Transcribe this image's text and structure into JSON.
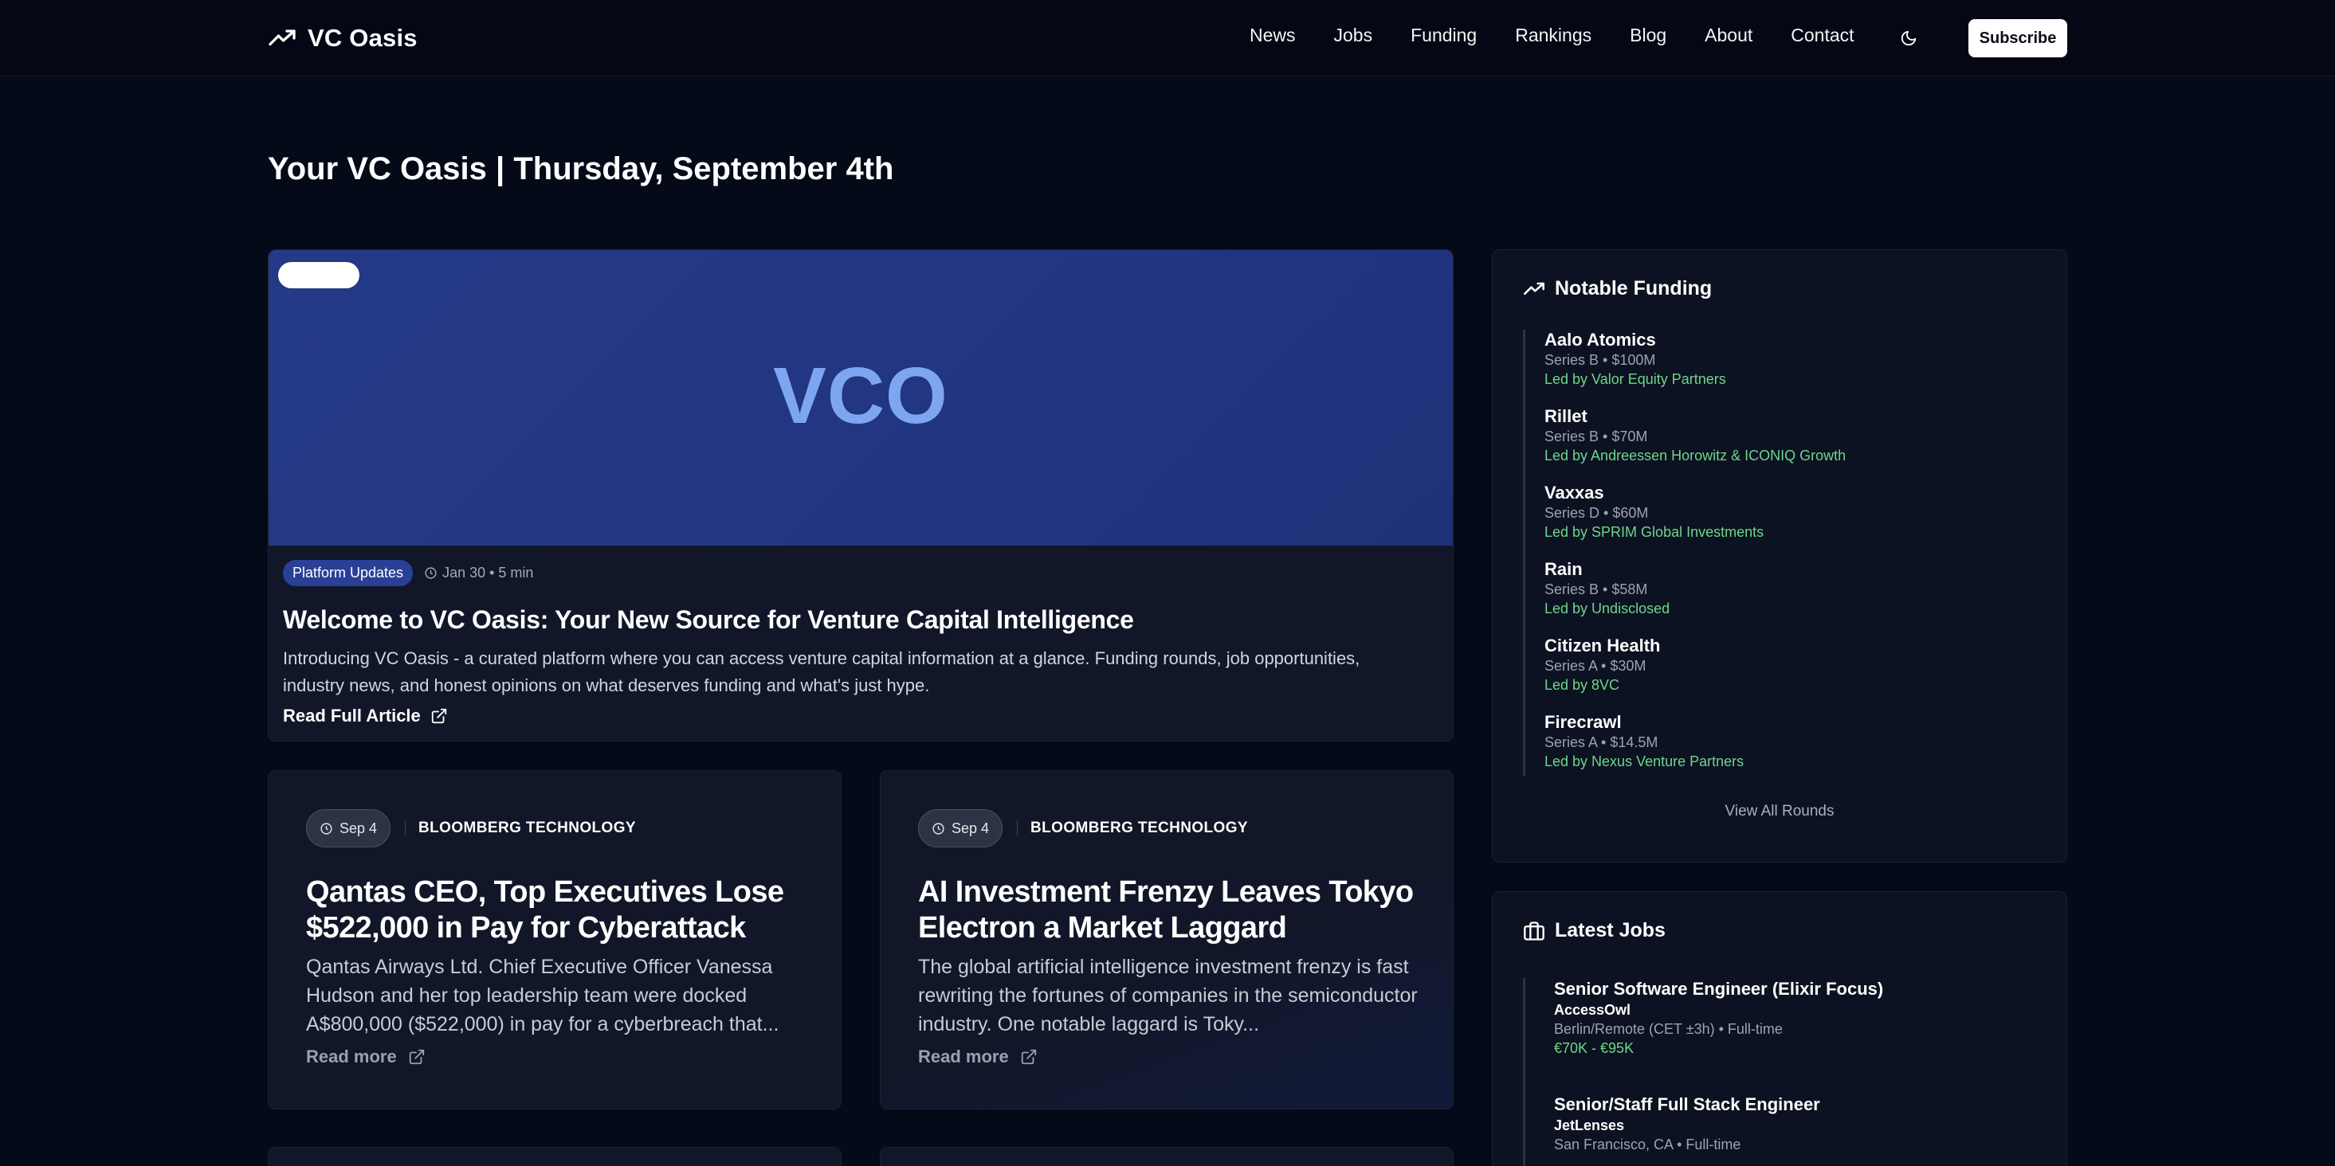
{
  "nav": {
    "brand": "VC Oasis",
    "links": [
      "News",
      "Jobs",
      "Funding",
      "Rankings",
      "Blog",
      "About",
      "Contact"
    ],
    "subscribe_label": "Subscribe"
  },
  "page_title": "Your VC Oasis | Thursday, September 4th",
  "featured": {
    "hero_logo": "VCO",
    "category": "Platform Updates",
    "meta": "Jan 30 • 5 min",
    "title": "Welcome to VC Oasis: Your New Source for Venture Capital Intelligence",
    "excerpt": "Introducing VC Oasis - a curated platform where you can access venture capital information at a glance. Funding rounds, job opportunities, industry news, and honest opinions on what deserves funding and what's just hype.",
    "read_label": "Read Full Article"
  },
  "news": [
    {
      "date": "Sep 4",
      "source": "BLOOMBERG TECHNOLOGY",
      "title": "Qantas CEO, Top Executives Lose $522,000 in Pay for Cyberattack",
      "excerpt": "Qantas Airways Ltd. Chief Executive Officer Vanessa Hudson and her top leadership team were docked A$800,000 ($522,000) in pay for a cyberbreach that...",
      "read_label": "Read more"
    },
    {
      "date": "Sep 4",
      "source": "BLOOMBERG TECHNOLOGY",
      "title": "AI Investment Frenzy Leaves Tokyo Electron a Market Laggard",
      "excerpt": "The global artificial intelligence investment frenzy is fast rewriting the fortunes of companies in the semiconductor industry. One notable laggard is Toky...",
      "read_label": "Read more"
    }
  ],
  "funding": {
    "heading": "Notable Funding",
    "items": [
      {
        "name": "Aalo Atomics",
        "series": "Series B • $100M",
        "lead": "Led by Valor Equity Partners"
      },
      {
        "name": "Rillet",
        "series": "Series B • $70M",
        "lead": "Led by Andreessen Horowitz & ICONIQ Growth"
      },
      {
        "name": "Vaxxas",
        "series": "Series D • $60M",
        "lead": "Led by SPRIM Global Investments"
      },
      {
        "name": "Rain",
        "series": "Series B • $58M",
        "lead": "Led by Undisclosed"
      },
      {
        "name": "Citizen Health",
        "series": "Series A • $30M",
        "lead": "Led by 8VC"
      },
      {
        "name": "Firecrawl",
        "series": "Series A • $14.5M",
        "lead": "Led by Nexus Venture Partners"
      }
    ],
    "view_all_label": "View All Rounds"
  },
  "jobs": {
    "heading": "Latest Jobs",
    "items": [
      {
        "title": "Senior Software Engineer (Elixir Focus)",
        "company": "AccessOwl",
        "location": "Berlin/Remote (CET ±3h) • Full-time",
        "salary": "€70K - €95K"
      },
      {
        "title": "Senior/Staff Full Stack Engineer",
        "company": "JetLenses",
        "location": "San Francisco, CA • Full-time",
        "salary": ""
      }
    ]
  },
  "colors": {
    "background": "#050a18",
    "card": "#111728",
    "hero": "#243884",
    "accent_green": "#6fd68b",
    "badge": "#2a3f96"
  }
}
